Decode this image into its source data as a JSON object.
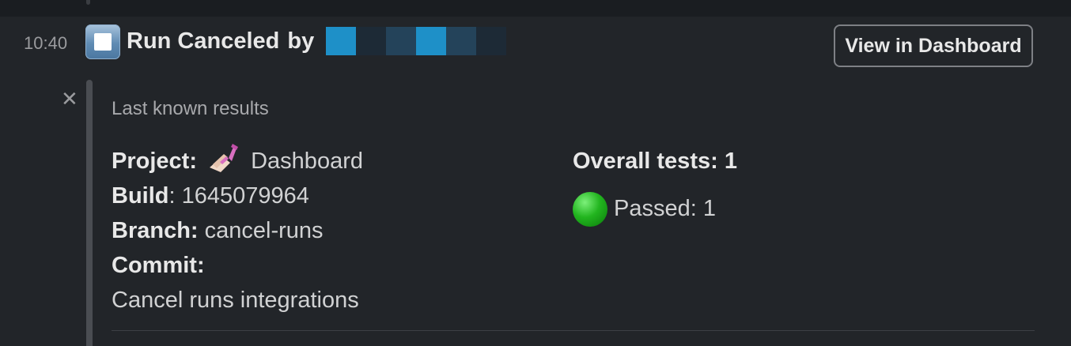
{
  "message": {
    "timestamp": "10:40",
    "status_icon": "stop-button-icon",
    "title": "Run Canceled",
    "by_label": "by",
    "author_redaction_colors": [
      "#1e90c8",
      "#1d2a36",
      "#24435a",
      "#1e90c8",
      "#24435a",
      "#1d2a36"
    ],
    "action_button": "View in Dashboard"
  },
  "attachment": {
    "close_icon": "close-icon",
    "subtitle": "Last known results",
    "project_label": "Project:",
    "project_icon": "nail-polish-icon",
    "project_value": "Dashboard",
    "build_label": "Build",
    "build_sep": ":",
    "build_value": "1645079964",
    "branch_label": "Branch:",
    "branch_value": "cancel-runs",
    "commit_label": "Commit:",
    "commit_value": "Cancel runs integrations",
    "overall_label": "Overall tests: 1",
    "passed_icon": "green-circle-icon",
    "passed_text": "Passed: 1"
  },
  "colors": {
    "background": "#222529",
    "passed": "#22b51f"
  }
}
